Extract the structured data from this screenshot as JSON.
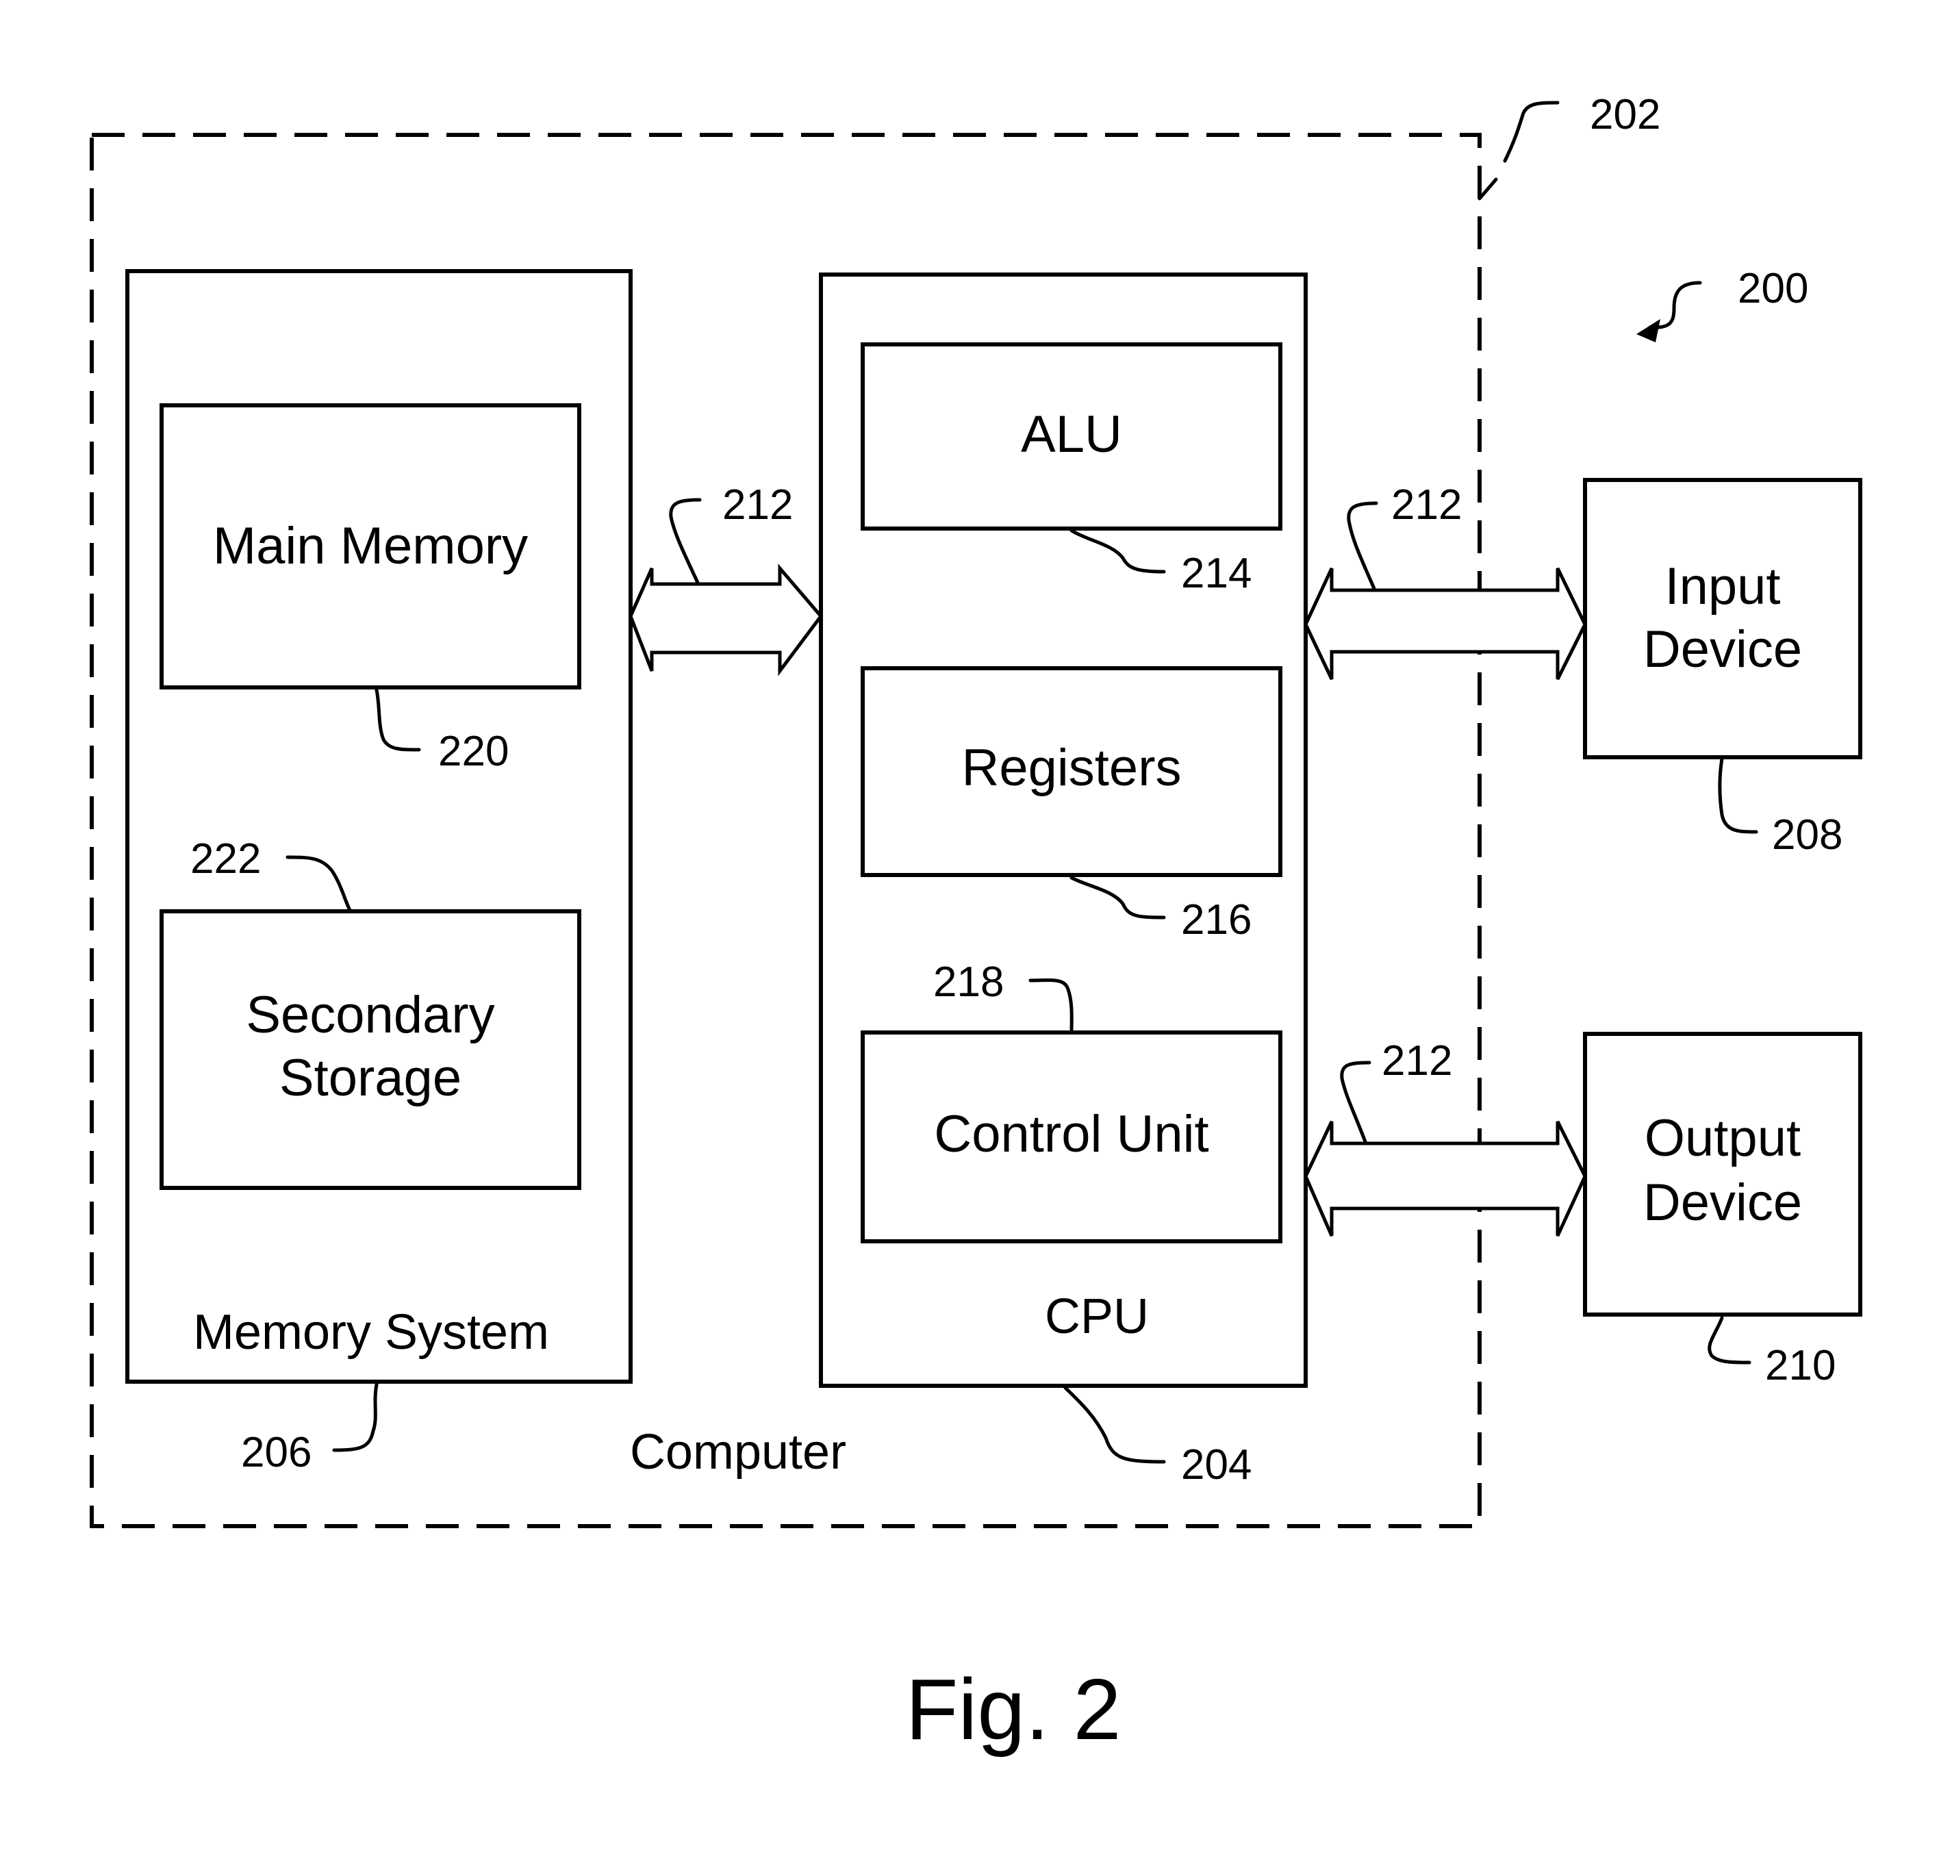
{
  "figure": {
    "caption": "Fig. 2",
    "system_ref": "200",
    "computer": {
      "label": "Computer",
      "ref": "202"
    },
    "memory_system": {
      "label": "Memory System",
      "ref": "206",
      "main_memory": {
        "label": "Main Memory",
        "ref": "220"
      },
      "secondary_storage": {
        "line1": "Secondary",
        "line2": "Storage",
        "ref": "222"
      }
    },
    "cpu": {
      "label": "CPU",
      "ref": "204",
      "alu": {
        "label": "ALU",
        "ref": "214"
      },
      "registers": {
        "label": "Registers",
        "ref": "216"
      },
      "control_unit": {
        "label": "Control Unit",
        "ref": "218"
      }
    },
    "input_device": {
      "line1": "Input",
      "line2": "Device",
      "ref": "208"
    },
    "output_device": {
      "line1": "Output",
      "line2": "Device",
      "ref": "210"
    },
    "bus": {
      "ref": "212"
    }
  }
}
